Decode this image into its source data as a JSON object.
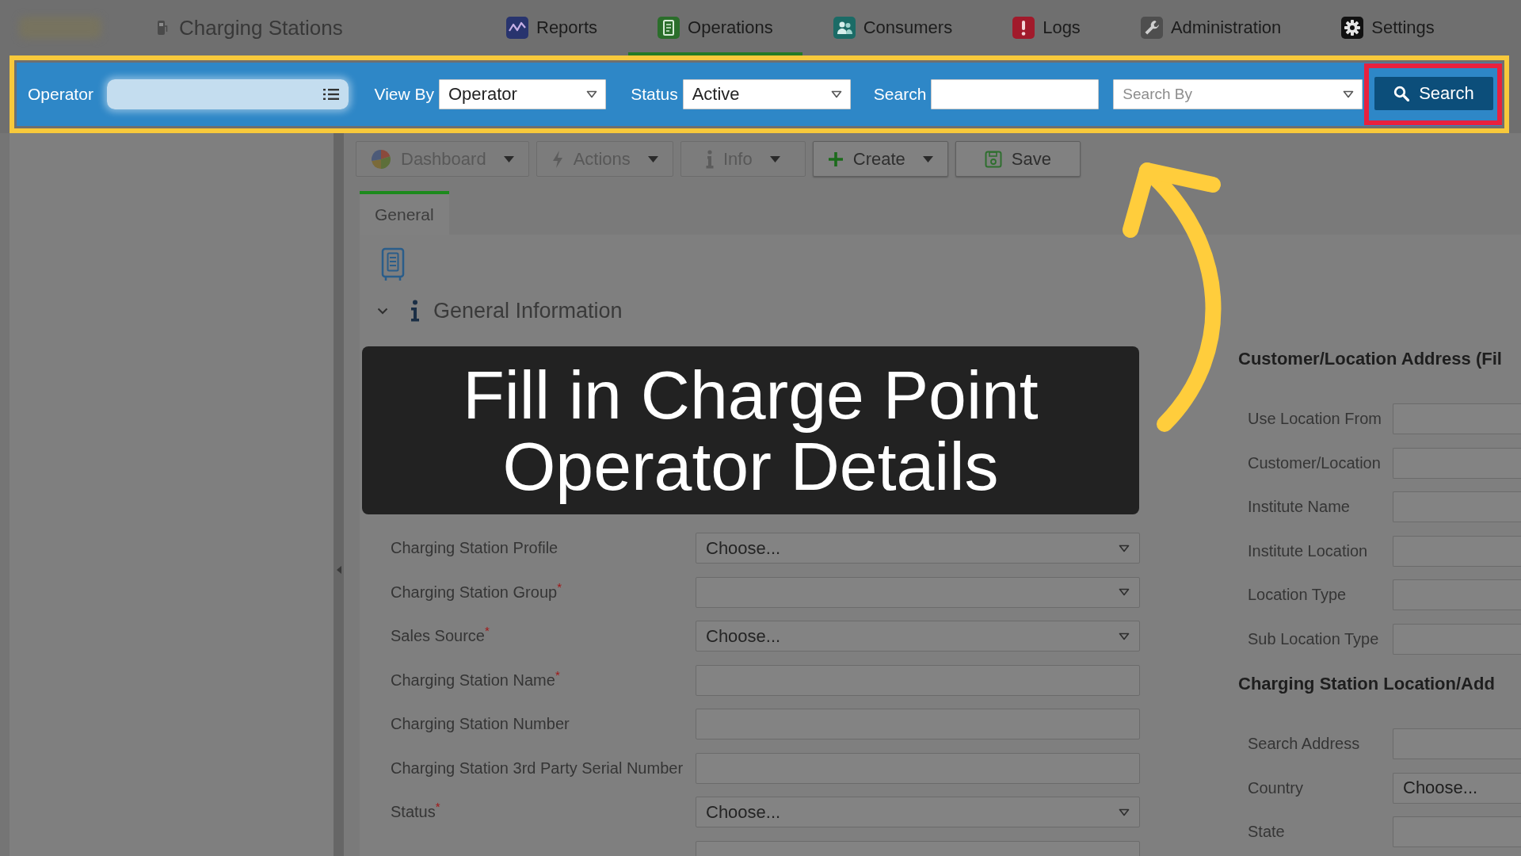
{
  "header": {
    "app_title": "Charging Stations",
    "nav": [
      {
        "label": "Reports",
        "selected": false
      },
      {
        "label": "Operations",
        "selected": true
      },
      {
        "label": "Consumers",
        "selected": false
      },
      {
        "label": "Logs",
        "selected": false
      },
      {
        "label": "Administration",
        "selected": false
      },
      {
        "label": "Settings",
        "selected": false
      }
    ]
  },
  "filter_bar": {
    "highlighted": true,
    "operator": {
      "label": "Operator"
    },
    "view_by": {
      "label": "View By",
      "value": "Operator"
    },
    "status": {
      "label": "Status",
      "value": "Active"
    },
    "search": {
      "label": "Search"
    },
    "search_by": {
      "placeholder": "Search By"
    },
    "search_button": {
      "label": "Search",
      "highlighted": true
    }
  },
  "toolbar": [
    {
      "label": "Dashboard",
      "disabled": true,
      "has_menu": true
    },
    {
      "label": "Actions",
      "disabled": true,
      "has_menu": true
    },
    {
      "label": "Info",
      "disabled": true,
      "has_menu": true
    },
    {
      "label": "Create",
      "disabled": false,
      "has_menu": true
    },
    {
      "label": "Save",
      "disabled": false,
      "has_menu": false
    }
  ],
  "tabs": [
    {
      "label": "General",
      "selected": true
    }
  ],
  "section": {
    "title": "General Information",
    "expanded": true
  },
  "form_left": [
    {
      "label": "Charging Station Profile",
      "kind": "select",
      "value": "Choose..."
    },
    {
      "label": "Charging Station Group$^{*}$",
      "kind": "select"
    },
    {
      "label": "Sales Source$^{*}$",
      "kind": "select",
      "value": "Choose..."
    },
    {
      "label": "Charging Station Name$^{*}$",
      "kind": "text"
    },
    {
      "label": "Charging Station Number",
      "kind": "text"
    },
    {
      "label": "Charging Station 3rd Party Serial Number",
      "kind": "text"
    },
    {
      "label": "Status$^{*}$",
      "kind": "select",
      "value": "Choose..."
    },
    {
      "kind": "text"
    }
  ],
  "form_right": [
    {
      "title": "Customer/Location Address (Fil",
      "fields": [
        {
          "label": "Use Location From"
        },
        {
          "label": "Customer/Location"
        },
        {
          "label": "Institute Name"
        },
        {
          "label": "Institute Location"
        },
        {
          "label": "Location Type"
        },
        {
          "label": "Sub Location Type"
        }
      ]
    },
    {
      "title": "Charging Station Location/Add",
      "fields": [
        {
          "label": "Search Address"
        },
        {
          "label": "Country",
          "value": "Choose..."
        },
        {
          "label": "State"
        }
      ]
    }
  ],
  "tutorial": {
    "caption": "Fill in Charge Point Operator Details"
  }
}
